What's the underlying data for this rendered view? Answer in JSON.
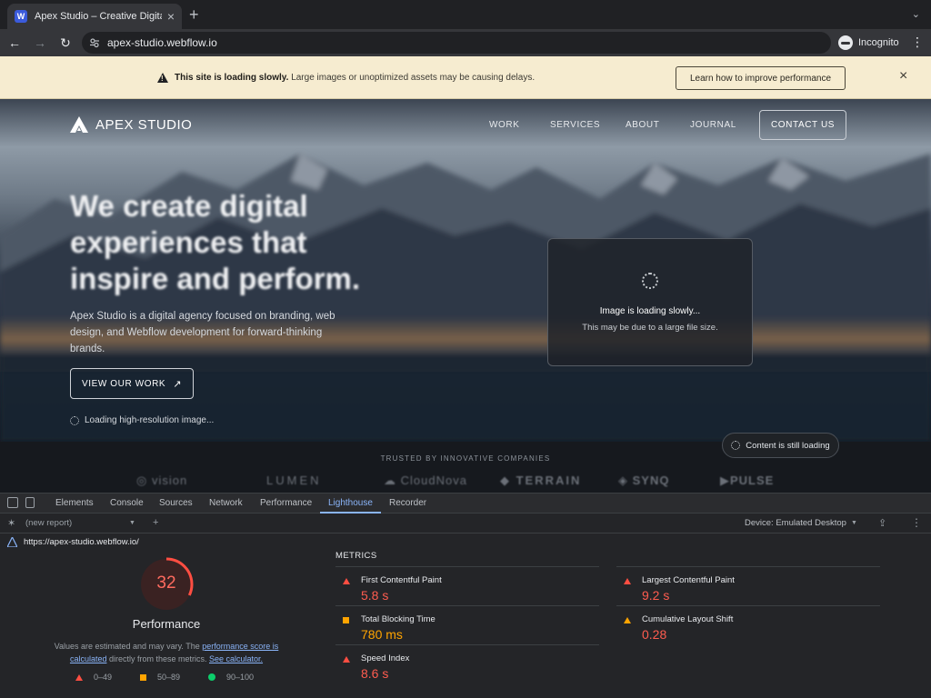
{
  "browser": {
    "tab_title": "Apex Studio – Creative Digital Agency",
    "favicon_letter": "W",
    "url": "apex-studio.webflow.io",
    "incognito_label": "Incognito"
  },
  "banner": {
    "bold_text": "This site is loading slowly.",
    "text": "Large images or unoptimized assets may be causing delays.",
    "button_label": "Learn how to improve performance"
  },
  "site": {
    "logo_text": "APEX STUDIO",
    "nav": [
      "WORK",
      "SERVICES",
      "ABOUT",
      "JOURNAL"
    ],
    "contact_label": "CONTACT US",
    "headline": "We create digital experiences that inspire and perform.",
    "subtext": "Apex Studio is a digital agency focused on branding, web design, and Webflow development for forward-thinking brands.",
    "cta_label": "VIEW OUR WORK",
    "cta_arrow": "↗",
    "loading_hi": "Loading high-resolution image...",
    "image_card": {
      "title": "Image is loading slowly...",
      "subtitle": "This may be due to a large file size."
    },
    "trusted_title": "TRUSTED BY INNOVATIVE COMPANIES",
    "brands": [
      "vision",
      "LUMEN",
      "CloudNova",
      "TERRAIN",
      "SYNQ",
      "PULSE"
    ],
    "still_loading": "Content is still loading"
  },
  "devtools": {
    "tabs": [
      "Elements",
      "Console",
      "Sources",
      "Network",
      "Performance",
      "Lighthouse",
      "Recorder"
    ],
    "active_tab": "Lighthouse",
    "report_select": "(new report)",
    "device": "Device: Emulated Desktop",
    "report_url": "https://apex-studio.webflow.io/",
    "score": "32",
    "score_fraction": 0.32,
    "score_label": "Performance",
    "note_prefix": "Values are estimated and may vary. The ",
    "note_link1": "performance score is calculated",
    "note_middle": " directly from these metrics. ",
    "note_link2": "See calculator.",
    "legend": [
      "0–49",
      "50–89",
      "90–100"
    ],
    "metrics_title": "METRICS",
    "metrics": [
      {
        "name": "First Contentful Paint",
        "value": "5.8 s",
        "status": "bad"
      },
      {
        "name": "Largest Contentful Paint",
        "value": "9.2 s",
        "status": "bad"
      },
      {
        "name": "Total Blocking Time",
        "value": "780 ms",
        "status": "average"
      },
      {
        "name": "Cumulative Layout Shift",
        "value": "0.28",
        "status": "average"
      },
      {
        "name": "Speed Index",
        "value": "8.6 s",
        "status": "bad"
      }
    ],
    "colors": {
      "bad": "#ff4e42",
      "average": "#ffa400",
      "good": "#0cce6b"
    }
  }
}
